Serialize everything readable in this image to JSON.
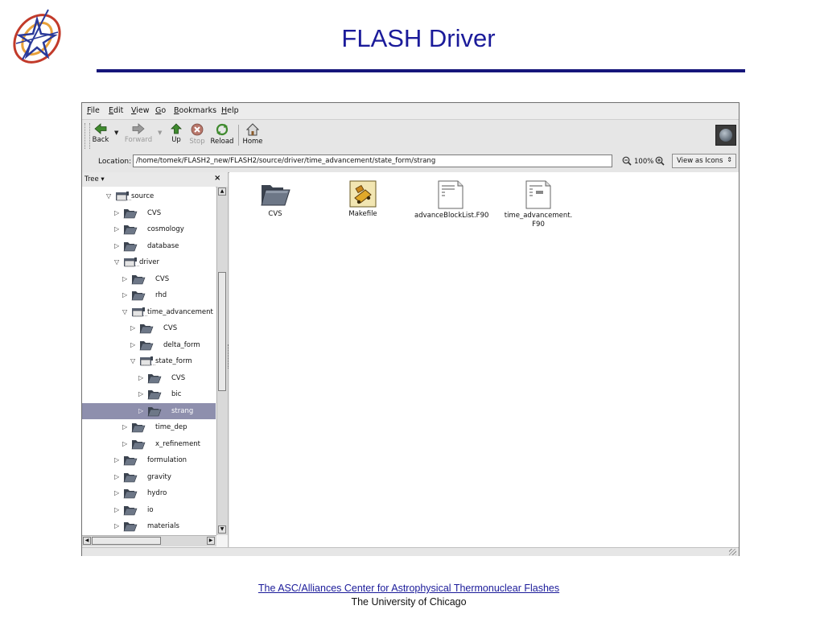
{
  "slide": {
    "title": "FLASH Driver",
    "footer_link": "The ASC/Alliances Center for Astrophysical Thermonuclear Flashes",
    "footer_sub": "The University of Chicago"
  },
  "menubar": {
    "items": [
      {
        "key": "F",
        "rest": "ile"
      },
      {
        "key": "E",
        "rest": "dit"
      },
      {
        "key": "V",
        "rest": "iew"
      },
      {
        "key": "G",
        "rest": "o"
      },
      {
        "key": "B",
        "rest": "ookmarks"
      },
      {
        "key": "H",
        "rest": "elp"
      }
    ]
  },
  "toolbar": {
    "back": "Back",
    "forward": "Forward",
    "up": "Up",
    "stop": "Stop",
    "reload": "Reload",
    "home": "Home"
  },
  "location": {
    "label": "Location:",
    "value": "/home/tomek/FLASH2_new/FLASH2/source/driver/time_advancement/state_form/strang",
    "zoom": "100%",
    "view_mode": "View as Icons"
  },
  "sidepane": {
    "title": "Tree ▾",
    "close": "×",
    "tree": [
      {
        "label": "source",
        "expanded": true
      },
      {
        "label": "CVS",
        "expanded": false
      },
      {
        "label": "cosmology",
        "expanded": false
      },
      {
        "label": "database",
        "expanded": false
      },
      {
        "label": "driver",
        "expanded": true
      },
      {
        "label": "CVS",
        "expanded": false
      },
      {
        "label": "rhd",
        "expanded": false
      },
      {
        "label": "time_advancement",
        "expanded": true
      },
      {
        "label": "CVS",
        "expanded": false
      },
      {
        "label": "delta_form",
        "expanded": false
      },
      {
        "label": "state_form",
        "expanded": true
      },
      {
        "label": "CVS",
        "expanded": false
      },
      {
        "label": "bic",
        "expanded": false
      },
      {
        "label": "strang",
        "expanded": false,
        "selected": true
      },
      {
        "label": "time_dep",
        "expanded": false
      },
      {
        "label": "x_refinement",
        "expanded": false
      },
      {
        "label": "formulation",
        "expanded": false
      },
      {
        "label": "gravity",
        "expanded": false
      },
      {
        "label": "hydro",
        "expanded": false
      },
      {
        "label": "io",
        "expanded": false
      },
      {
        "label": "materials",
        "expanded": false
      }
    ]
  },
  "files": [
    {
      "name": "CVS",
      "kind": "folder"
    },
    {
      "name": "Makefile",
      "kind": "makefile"
    },
    {
      "name": "advanceBlockList.F90",
      "kind": "text"
    },
    {
      "name": "time_advancement.\nF90",
      "kind": "text"
    }
  ],
  "colors": {
    "title": "#1b1b9a",
    "selection": "#8e8fad",
    "folder": "#4f5866"
  }
}
